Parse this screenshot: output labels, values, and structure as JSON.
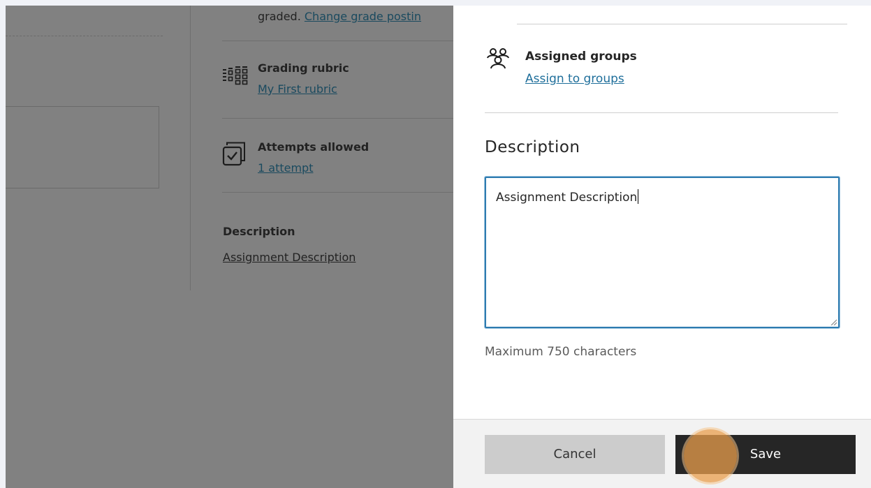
{
  "background_page": {
    "grade_posting": {
      "prefix": "graded.",
      "link": "Change grade postin"
    },
    "grading_rubric": {
      "title": "Grading rubric",
      "value": "My First rubric"
    },
    "attempts_allowed": {
      "title": "Attempts allowed",
      "value": "1 attempt"
    },
    "description": {
      "title": "Description",
      "value": "Assignment Description"
    }
  },
  "panel": {
    "assigned_groups": {
      "title": "Assigned groups",
      "link": "Assign to groups"
    },
    "description": {
      "heading": "Description",
      "value": "Assignment Description",
      "hint": "Maximum 750 characters"
    },
    "footer": {
      "cancel_label": "Cancel",
      "save_label": "Save"
    }
  },
  "icons": {
    "groups": "groups-icon",
    "rubric": "rubric-grid-icon",
    "attempts": "attempts-checkbox-icon",
    "resize": "resize-grip-icon"
  },
  "colors": {
    "overlay_background": "#818181",
    "link": "#1f6f9b",
    "save_button": "#262626",
    "cancel_button": "#cccccc",
    "focus_border": "#2e7bb0",
    "click_indicator": "#e89e4c"
  }
}
